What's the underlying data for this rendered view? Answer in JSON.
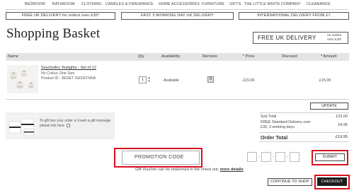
{
  "nav": {
    "items": [
      "BEDROOM",
      "BATHROOM",
      "CLOTHING",
      "CANDLES & FRAGRANCE",
      "HOME ACCESSORIES",
      "FURNITURE",
      "GIFTS",
      "THE LITTLE WHITE COMPANY",
      "CLEARANCE"
    ]
  },
  "promos": [
    "FREE UK DELIVERY for orders over £30*",
    "FAST 3 WORKING DAY UK DELIVERY",
    "INTERNATIONAL DELIVERY FROM £7"
  ],
  "page_title": "Shopping Basket",
  "free_delivery": {
    "label": "FREE UK DELIVERY",
    "note": "on orders\nover £30*"
  },
  "table": {
    "headers": {
      "name": "Name",
      "qty": "Qty",
      "availability": "Availability",
      "remove": "Remove",
      "price": "* Price",
      "discount": "Discount",
      "amount": "* Amount"
    },
    "rows": [
      {
        "name": "Seychelles Tealights - Set of 12",
        "variant": "No Colour, One Size",
        "product_id": "Product ID : SEDET /SEDETNNA",
        "qty": "1",
        "availability": "Available",
        "remove": "X",
        "price": "£15.00",
        "discount": "",
        "amount": "£15.00"
      }
    ]
  },
  "icons": {
    "qty_up": "chevron-up-icon",
    "qty_down": "chevron-down-icon",
    "remove": "close-icon"
  },
  "update_button": "UPDATE",
  "gift": {
    "text": "To gift box your order or insert a gift message please tick here"
  },
  "summary": {
    "subtotal_label": "Sub Total",
    "subtotal_value": "£15.00",
    "delivery_label": "FREE Standard Delivery over £30, 3 working days",
    "delivery_value": "£4.95",
    "total_label": "Order Total",
    "total_value": "£19.95"
  },
  "promotion": {
    "placeholder": "PROMOTION CODE",
    "submit": "SUBMIT",
    "voucher_note": "Gift Voucher can be redeemed in the check out,",
    "voucher_link": "more details"
  },
  "buttons": {
    "continue": "CONTINUE TO SHOP",
    "checkout": "CHECKOUT"
  },
  "colors": {
    "highlight_frame": "#d8101e",
    "checkout_bg": "#1e1e1e",
    "table_header_bg": "#e4e4e4"
  }
}
